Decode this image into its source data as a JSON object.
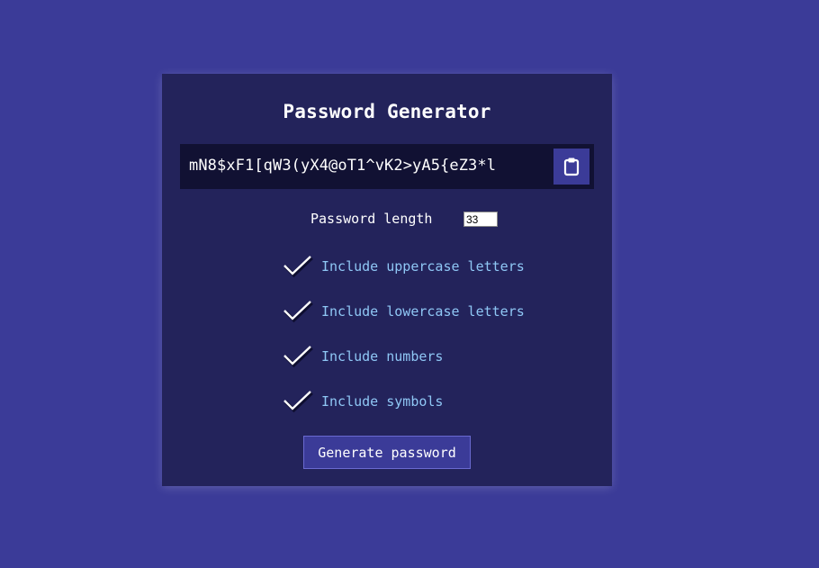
{
  "title": "Password Generator",
  "result": {
    "password": "mN8$xF1[qW3(yX4@oT1^vK2>yA5{eZ3*l",
    "copy_icon": "clipboard-icon"
  },
  "length": {
    "label": "Password length",
    "value": "33"
  },
  "options": [
    {
      "label": "Include uppercase letters",
      "checked": true
    },
    {
      "label": "Include lowercase letters",
      "checked": true
    },
    {
      "label": "Include numbers",
      "checked": true
    },
    {
      "label": "Include symbols",
      "checked": true
    }
  ],
  "generate_label": "Generate password",
  "colors": {
    "background": "#3b3b98",
    "card": "#23235b",
    "result_bg": "#111133",
    "accent": "#3b3b98",
    "option_text": "#8fc7f5"
  }
}
